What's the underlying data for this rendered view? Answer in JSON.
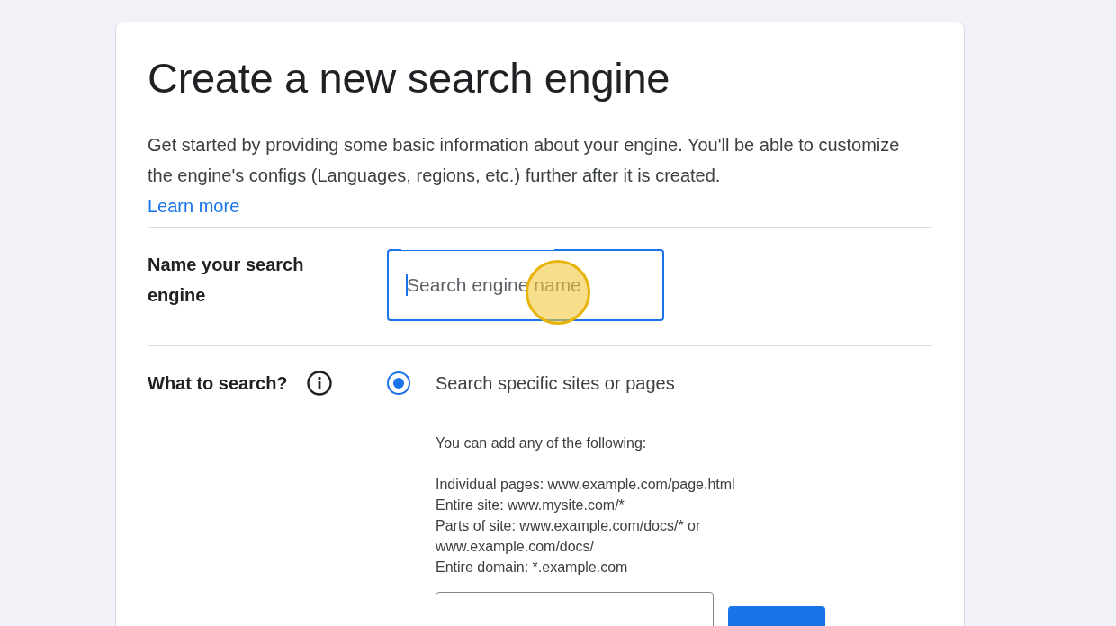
{
  "title": "Create a new search engine",
  "description": "Get started by providing some basic information about your engine. You'll be able to customize the engine's configs (Languages, regions, etc.) further after it is created.",
  "learn_more": "Learn more",
  "name_row": {
    "label": "Name your search engine",
    "placeholder": "Search engine name",
    "focused": true
  },
  "what_row": {
    "label": "What to search?",
    "options": [
      {
        "label": "Search specific sites or pages",
        "selected": true
      }
    ],
    "help_intro": "You can add any of the following:",
    "help_lines": [
      "Individual pages: www.example.com/page.html",
      "Entire site: www.mysite.com/*",
      "Parts of site: www.example.com/docs/* or www.example.com/docs/",
      "Entire domain: *.example.com"
    ]
  }
}
